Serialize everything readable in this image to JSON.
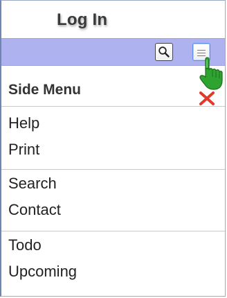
{
  "window": {
    "title": "Log In"
  },
  "toolbar": {
    "search_icon": "magnifier-icon",
    "menu_icon": "hamburger-menu-icon",
    "pointer_icon": "hand-pointer-icon"
  },
  "side_menu": {
    "header_label": "Side Menu",
    "close_icon": "red-x-close-icon",
    "groups": [
      {
        "items": [
          {
            "label": "Help"
          },
          {
            "label": "Print"
          }
        ]
      },
      {
        "items": [
          {
            "label": "Search"
          },
          {
            "label": "Contact"
          }
        ]
      },
      {
        "items": [
          {
            "label": "Todo"
          },
          {
            "label": "Upcoming"
          }
        ]
      }
    ]
  },
  "colors": {
    "toolbar_bg": "#aeb2ef",
    "close_x": "#e03a2a",
    "hand_green": "#2fa32f"
  }
}
